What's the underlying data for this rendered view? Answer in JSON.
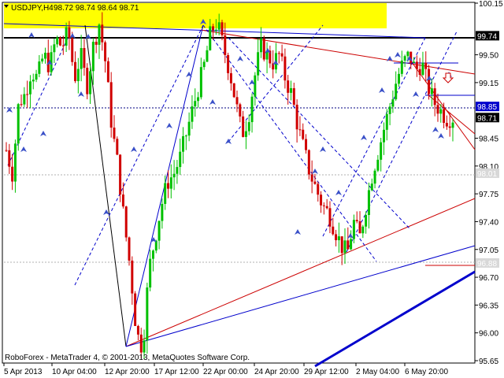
{
  "header": {
    "symbol": "USDJPY,H4",
    "ohlc": "98.72 98.74 98.64 98.71"
  },
  "footer": {
    "copyright": "RoboForex - MetaTrader 4, © 2001-2013, MetaQuotes Software Corp."
  },
  "colors": {
    "bull": "#00c000",
    "bear": "#d00000",
    "highlight": "#ffff00",
    "resistance": "#000000",
    "trend_blue": "#0000cc",
    "trend_red": "#cc0000"
  },
  "icons": [
    "wave-arrow-icon",
    "down-arrow-outline-icon"
  ],
  "price_labels": [
    {
      "name": "level-99-74",
      "text": "99.74",
      "price": 99.74,
      "style": "black"
    },
    {
      "name": "level-98-85",
      "text": "98.85",
      "price": 98.85,
      "style": "blue"
    },
    {
      "name": "level-98-71",
      "text": "98.71",
      "price": 98.71,
      "style": "black"
    },
    {
      "name": "level-98-01",
      "text": "98.01",
      "price": 98.01,
      "style": "grey"
    },
    {
      "name": "level-96-88",
      "text": "96.88",
      "price": 96.88,
      "style": "grey"
    }
  ],
  "chart_data": {
    "type": "candlestick",
    "symbol": "USDJPY,H4",
    "y_ticks": [
      "100.15",
      "99.50",
      "99.15",
      "98.45",
      "98.10",
      "97.75",
      "97.40",
      "97.05",
      "96.70",
      "96.35",
      "96.00",
      "95.65"
    ],
    "x_ticks": [
      "5 Apr 2013",
      "10 Apr 04:00",
      "12 Apr 20:00",
      "17 Apr 12:00",
      "22 Apr 00:00",
      "24 Apr 20:00",
      "29 Apr 12:00",
      "2 May 04:00",
      "6 May 20:00"
    ],
    "ylim": [
      95.65,
      100.15
    ],
    "series": [
      {
        "name": "price",
        "values": [
          98.3,
          98.0,
          98.9,
          99.0,
          99.3,
          99.2,
          99.5,
          99.35,
          99.7,
          99.6,
          99.8,
          99.2,
          99.5,
          99.1,
          99.6,
          99.9,
          99.4,
          98.6,
          98.1,
          97.4,
          96.8,
          96.0,
          95.8,
          96.8,
          97.2,
          97.6,
          97.9,
          98.0,
          98.2,
          98.5,
          98.8,
          99.1,
          99.4,
          99.8,
          99.9,
          99.6,
          99.3,
          98.9,
          98.5,
          98.7,
          99.2,
          99.6,
          99.5,
          99.4,
          99.5,
          99.2,
          99.0,
          98.6,
          98.3,
          98.0,
          97.8,
          97.6,
          97.5,
          97.3,
          97.1,
          97.0,
          97.4,
          97.2,
          97.6,
          98.0,
          98.3,
          98.6,
          98.9,
          99.2,
          99.4,
          99.5,
          99.3,
          99.4,
          99.1,
          98.9,
          98.8,
          98.7,
          98.71
        ]
      }
    ]
  }
}
